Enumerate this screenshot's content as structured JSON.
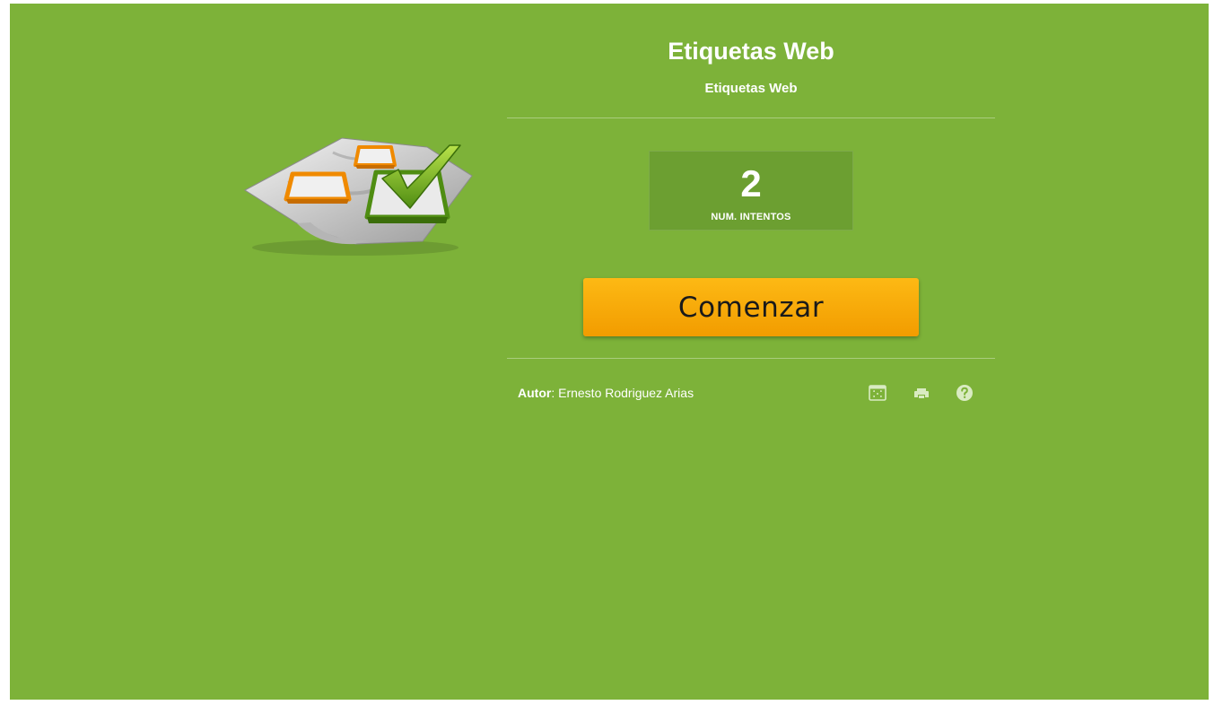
{
  "activity": {
    "title": "Etiquetas Web",
    "subtitle": "Etiquetas Web"
  },
  "stats": {
    "value": "2",
    "label": "NUM. INTENTOS"
  },
  "start_button": {
    "label": "Comenzar"
  },
  "author": {
    "key": "Autor",
    "separator": ": ",
    "name": "Ernesto Rodriguez Arias"
  },
  "toolbar": [
    {
      "icon": "fullscreen-icon"
    },
    {
      "icon": "print-icon"
    },
    {
      "icon": "help-icon"
    }
  ],
  "colors": {
    "background": "#7db239",
    "stat_box": "#6c9f31",
    "button_top": "#fdb914",
    "button_bottom": "#f29c00",
    "text": "#ffffff"
  }
}
